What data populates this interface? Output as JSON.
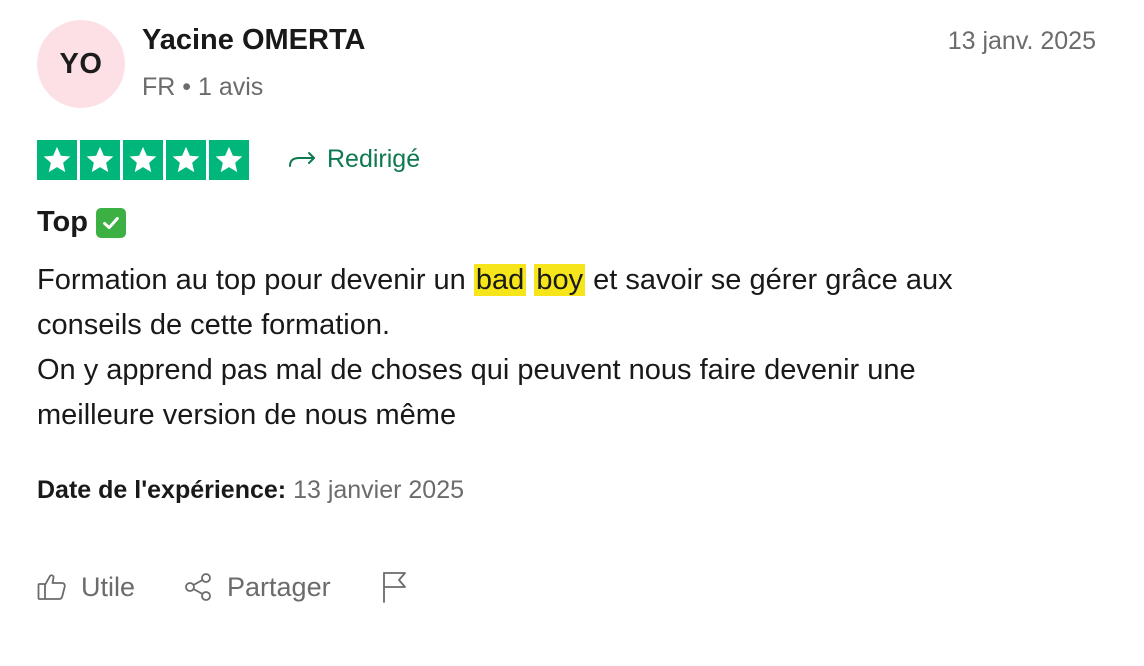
{
  "colors": {
    "star_green": "#00b67a",
    "avatar_bg": "#fde0e6",
    "redirect_green": "#0e7a4f",
    "highlight_yellow": "#f7e51b",
    "check_green": "#3cb043",
    "muted_gray": "#6b6b6b"
  },
  "author": {
    "initials": "YO",
    "name": "Yacine OMERTA",
    "meta": "FR • 1 avis"
  },
  "review": {
    "date": "13 janv. 2025",
    "rating": 5,
    "redirect_label": "Redirigé",
    "title": "Top",
    "title_emoji_icon": "check-mark-button-icon",
    "body": {
      "line1_before": "Formation au top pour devenir un ",
      "highlight1": "bad",
      "highlight2": "boy",
      "line1_after": " et savoir se gérer grâce aux",
      "line2": "conseils de cette formation.",
      "line3": "On y apprend pas mal de choses qui peuvent nous faire devenir une",
      "line4": "meilleure version de nous même"
    },
    "experience_label": "Date de l'expérience:",
    "experience_value": "13 janvier 2025"
  },
  "actions": {
    "useful_label": "Utile",
    "useful_icon": "thumbs-up-icon",
    "share_label": "Partager",
    "share_icon": "share-icon",
    "report_icon": "flag-icon"
  }
}
